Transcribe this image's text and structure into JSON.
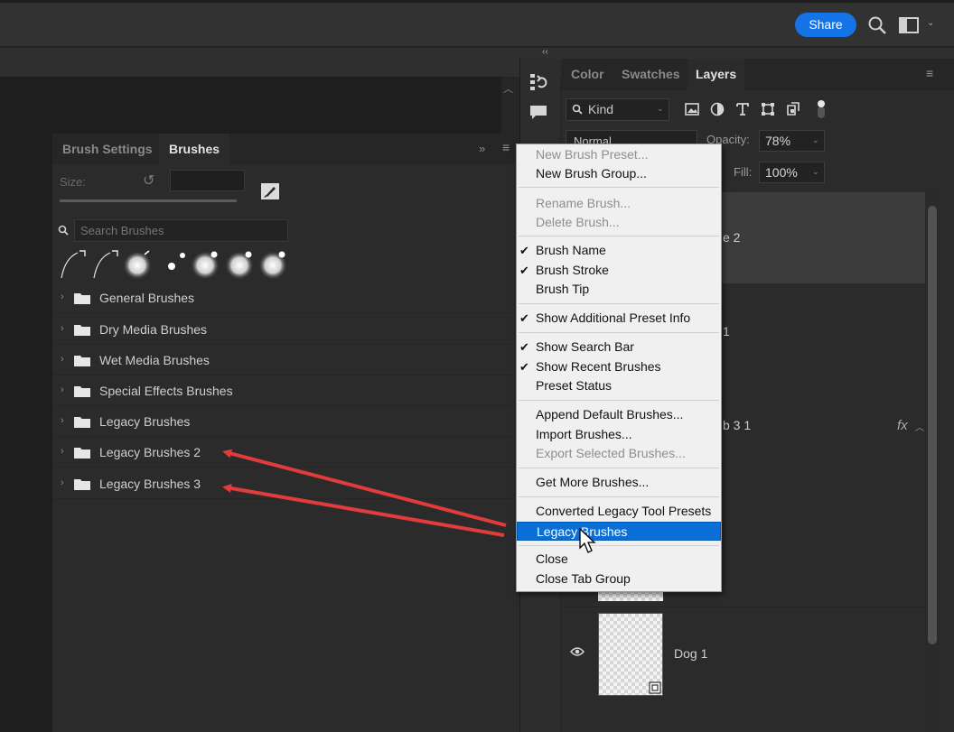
{
  "topbar": {
    "share_label": "Share"
  },
  "brush_panel": {
    "tabs": {
      "settings": "Brush Settings",
      "brushes": "Brushes"
    },
    "collapse_glyph": "»",
    "menu_glyph": "≡",
    "size_label": "Size:",
    "search_placeholder": "Search Brushes",
    "folders": [
      "General Brushes",
      "Dry Media Brushes",
      "Wet Media Brushes",
      "Special Effects Brushes",
      "Legacy Brushes",
      "Legacy Brushes 2",
      "Legacy Brushes 3"
    ]
  },
  "layers_panel": {
    "tabs": {
      "color": "Color",
      "swatches": "Swatches",
      "layers": "Layers"
    },
    "kind_label": "Kind",
    "blend_mode": "Normal",
    "opacity_label": "Opacity:",
    "opacity_value": "78%",
    "fill_label": "Fill:",
    "fill_value": "100%",
    "layer_fragments": [
      "e 2",
      "1",
      "b 3 1"
    ],
    "fx_label": "fx",
    "dog_layer": "Dog 1"
  },
  "context_menu": {
    "highlight_color": "#0a6fd6",
    "items": [
      {
        "label": "New Brush Preset...",
        "disabled": true,
        "checked": false
      },
      {
        "label": "New Brush Group...",
        "disabled": false,
        "checked": false
      },
      {
        "label": "Rename Brush...",
        "disabled": true,
        "checked": false
      },
      {
        "label": "Delete Brush...",
        "disabled": true,
        "checked": false
      },
      {
        "label": "Brush Name",
        "disabled": false,
        "checked": true
      },
      {
        "label": "Brush Stroke",
        "disabled": false,
        "checked": true
      },
      {
        "label": "Brush Tip",
        "disabled": false,
        "checked": false
      },
      {
        "label": "Show Additional Preset Info",
        "disabled": false,
        "checked": true
      },
      {
        "label": "Show Search Bar",
        "disabled": false,
        "checked": true
      },
      {
        "label": "Show Recent Brushes",
        "disabled": false,
        "checked": true
      },
      {
        "label": "Preset Status",
        "disabled": false,
        "checked": false
      },
      {
        "label": "Append Default Brushes...",
        "disabled": false,
        "checked": false
      },
      {
        "label": "Import Brushes...",
        "disabled": false,
        "checked": false
      },
      {
        "label": "Export Selected Brushes...",
        "disabled": true,
        "checked": false
      },
      {
        "label": "Get More Brushes...",
        "disabled": false,
        "checked": false
      },
      {
        "label": "Converted Legacy Tool Presets",
        "disabled": false,
        "checked": false
      },
      {
        "label": "Legacy Brushes",
        "disabled": false,
        "checked": false,
        "highlighted": true
      },
      {
        "label": "Close",
        "disabled": false,
        "checked": false
      },
      {
        "label": "Close Tab Group",
        "disabled": false,
        "checked": false
      }
    ]
  },
  "colors": {
    "accent": "#1473e6",
    "annotation_arrow": "#e23b3b"
  }
}
